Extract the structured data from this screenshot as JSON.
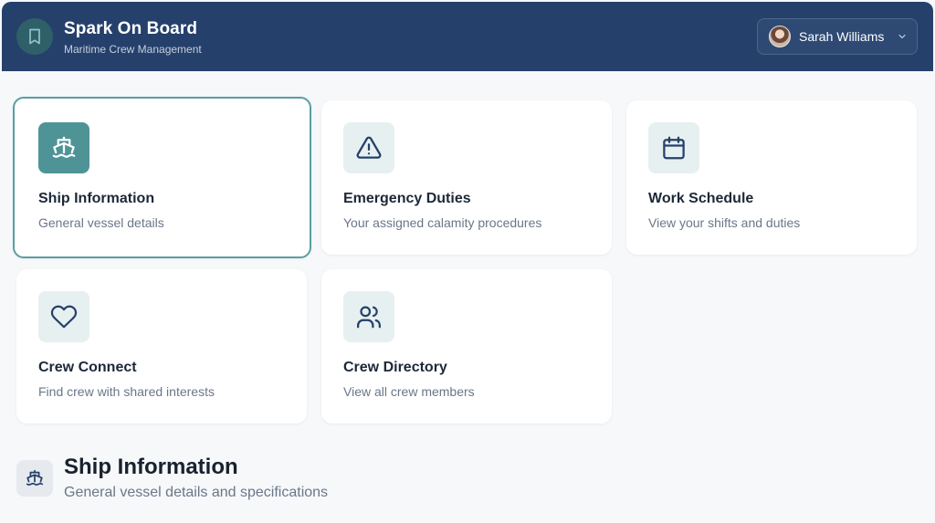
{
  "header": {
    "title": "Spark On Board",
    "subtitle": "Maritime Crew Management",
    "logo_icon": "bookmark-icon",
    "user": {
      "name": "Sarah Williams"
    }
  },
  "cards": [
    {
      "title": "Ship Information",
      "desc": "General vessel details",
      "icon": "ship-icon",
      "selected": true
    },
    {
      "title": "Emergency Duties",
      "desc": "Your assigned calamity procedures",
      "icon": "alert-triangle-icon"
    },
    {
      "title": "Work Schedule",
      "desc": "View your shifts and duties",
      "icon": "calendar-icon"
    },
    {
      "title": "Crew Connect",
      "desc": "Find crew with shared interests",
      "icon": "heart-icon"
    },
    {
      "title": "Crew Directory",
      "desc": "View all crew members",
      "icon": "users-icon"
    }
  ],
  "section": {
    "title": "Ship Information",
    "subtitle": "General vessel details and specifications",
    "icon": "ship-icon"
  },
  "colors": {
    "header_bg": "#25406b",
    "accent": "#4e9497",
    "icon_stroke": "#25406b"
  }
}
